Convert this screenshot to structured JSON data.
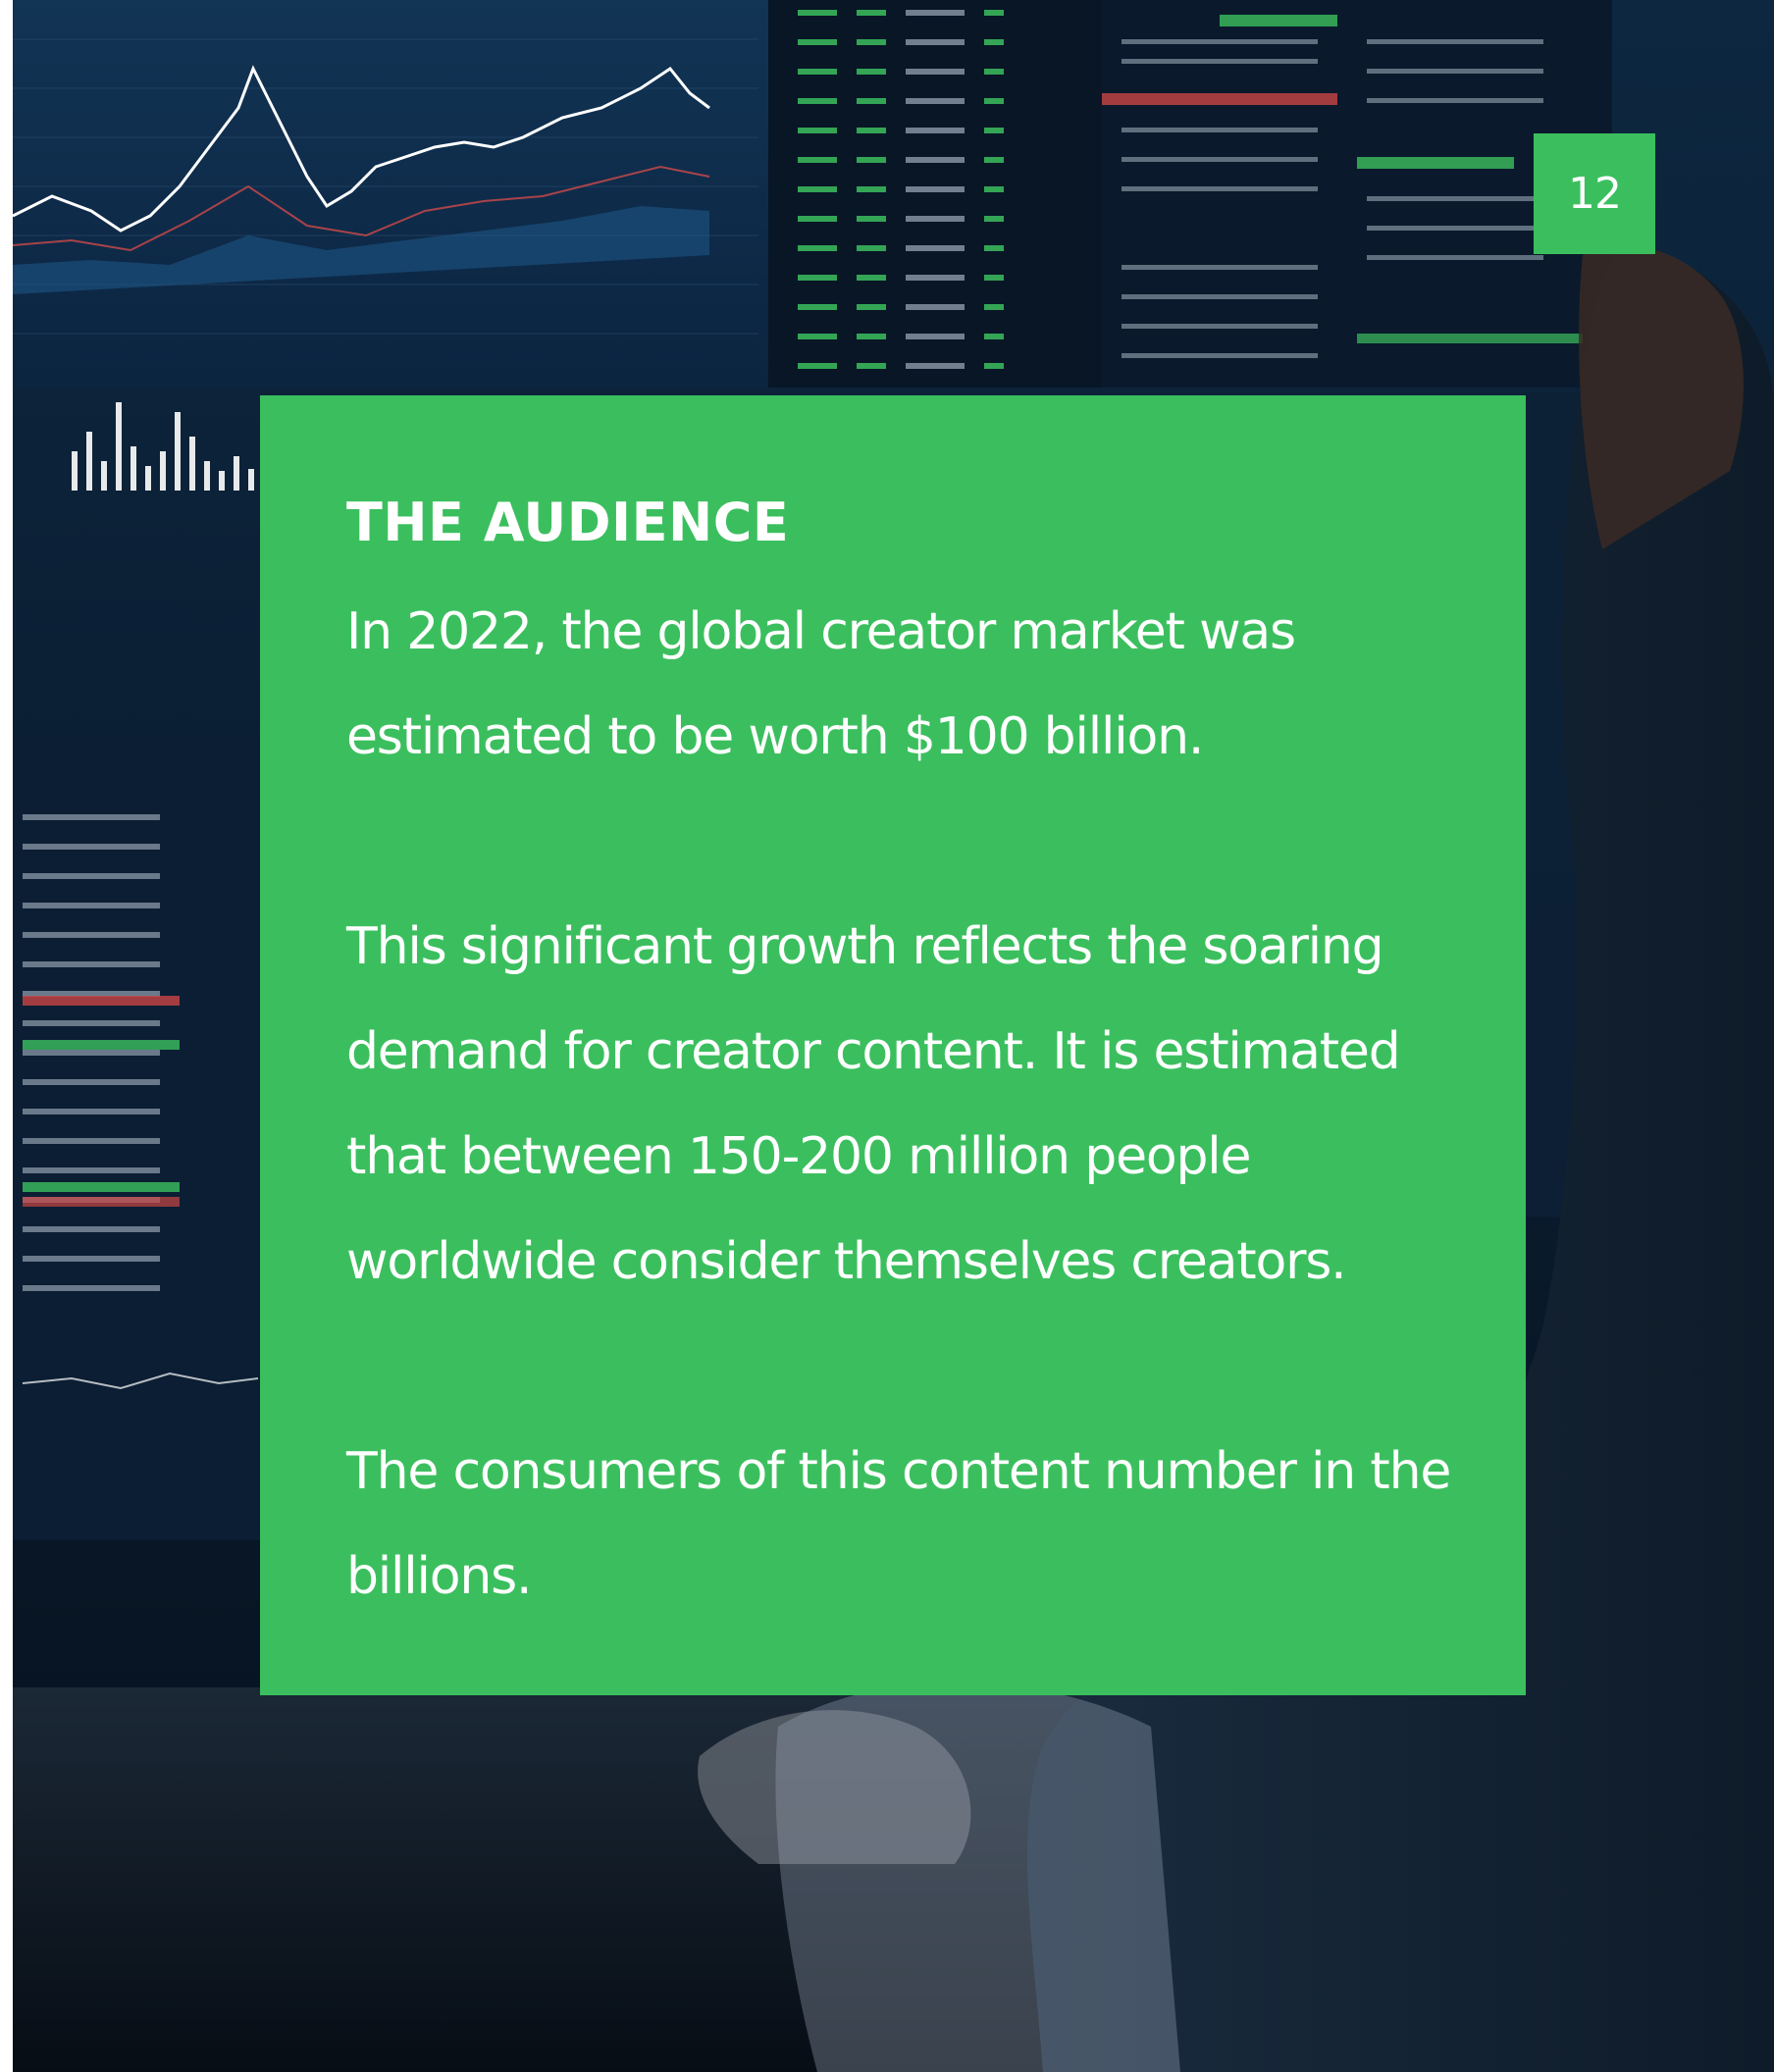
{
  "page": {
    "number": "12"
  },
  "card": {
    "heading": "THE AUDIENCE",
    "paragraphs": [
      "In 2022, the global creator market was estimated to be worth $100 billion.",
      "This significant growth reflects the soaring demand for creator content. It is estimated that between 150-200 million people worldwide consider themselves creators.",
      "The consumers of this content number in the billions."
    ]
  },
  "colors": {
    "accent_green": "#3bbf5e",
    "text_white": "#ffffff",
    "photo_dark_navy": "#0b1f33"
  }
}
